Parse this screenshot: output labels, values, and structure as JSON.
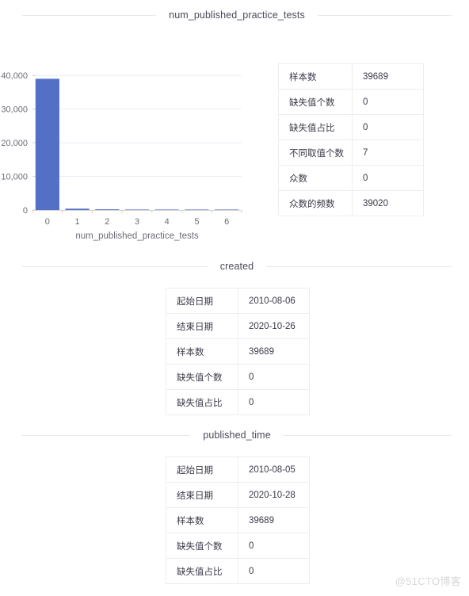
{
  "sections": [
    {
      "id": "num_published_practice_tests",
      "title": "num_published_practice_tests"
    },
    {
      "id": "created",
      "title": "created"
    },
    {
      "id": "published_time",
      "title": "published_time"
    }
  ],
  "chart_data": {
    "type": "bar",
    "title": "num_published_practice_tests",
    "xlabel": "num_published_practice_tests",
    "ylabel": "",
    "categories": [
      "0",
      "1",
      "2",
      "3",
      "4",
      "5",
      "6"
    ],
    "values": [
      39020,
      400,
      210,
      35,
      12,
      7,
      5
    ],
    "ytick_labels": [
      "0",
      "10,000",
      "20,000",
      "30,000",
      "40,000"
    ],
    "ytick_values": [
      0,
      10000,
      20000,
      30000,
      40000
    ],
    "ylim": [
      0,
      41000
    ],
    "grid": true,
    "legend": "none",
    "bar_color": "#5470c6"
  },
  "tables": {
    "num_published_practice_tests": {
      "rows": [
        {
          "label": "样本数",
          "value": "39689"
        },
        {
          "label": "缺失值个数",
          "value": "0"
        },
        {
          "label": "缺失值占比",
          "value": "0"
        },
        {
          "label": "不同取值个数",
          "value": "7"
        },
        {
          "label": "众数",
          "value": "0"
        },
        {
          "label": "众数的频数",
          "value": "39020"
        }
      ]
    },
    "created": {
      "rows": [
        {
          "label": "起始日期",
          "value": "2010-08-06"
        },
        {
          "label": "结束日期",
          "value": "2020-10-26"
        },
        {
          "label": "样本数",
          "value": "39689"
        },
        {
          "label": "缺失值个数",
          "value": "0"
        },
        {
          "label": "缺失值占比",
          "value": "0"
        }
      ]
    },
    "published_time": {
      "rows": [
        {
          "label": "起始日期",
          "value": "2010-08-05"
        },
        {
          "label": "结束日期",
          "value": "2020-10-28"
        },
        {
          "label": "样本数",
          "value": "39689"
        },
        {
          "label": "缺失值个数",
          "value": "0"
        },
        {
          "label": "缺失值占比",
          "value": "0"
        }
      ]
    }
  },
  "watermark": {
    "text": "@51CTO博客"
  },
  "colors": {
    "bar": "#5470c6",
    "grid": "#e9eef7",
    "axis": "#d4d4d4",
    "divider": "#e8e8e8",
    "table_border": "#ededed",
    "text": "#3a3a48",
    "tick_text": "#6b6b78"
  }
}
